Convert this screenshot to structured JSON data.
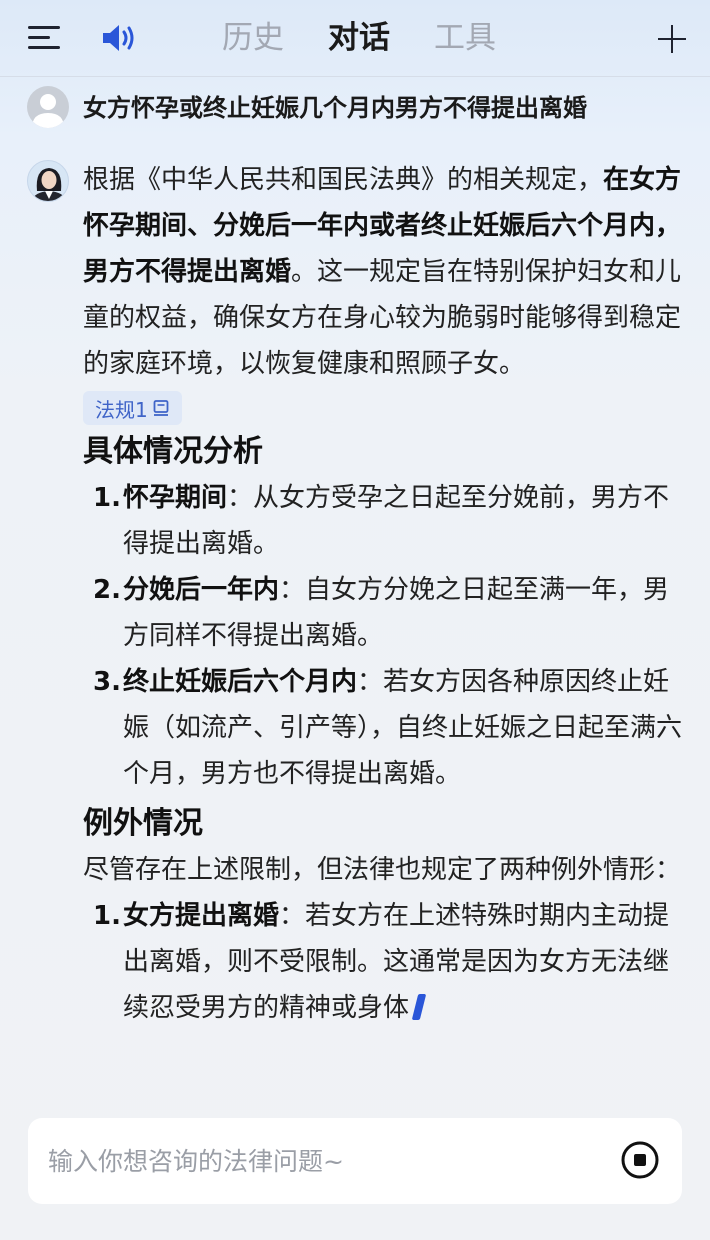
{
  "header": {
    "tabs": [
      {
        "label": "历史",
        "active": false
      },
      {
        "label": "对话",
        "active": true
      },
      {
        "label": "工具",
        "active": false
      }
    ],
    "icons": {
      "menu": "menu-icon",
      "speaker": "speaker-icon",
      "new_chat": "plus-icon"
    },
    "accent_color": "#2a56d8"
  },
  "question": {
    "text": "女方怀孕或终止妊娠几个月内男方不得提出离婚"
  },
  "answer": {
    "intro": {
      "pre": "根据《中华人民共和国民法典》的相关规定，",
      "bold": "在女方怀孕期间、分娩后一年内或者终止妊娠后六个月内，男方不得提出离婚",
      "post": "。这一规定旨在特别保护妇女和儿童的权益，确保女方在身心较为脆弱时能够得到稳定的家庭环境，以恢复健康和照顾子女。"
    },
    "citation": {
      "label": "法规1",
      "icon": "book-icon"
    },
    "section1": {
      "heading": "具体情况分析",
      "items": [
        {
          "num": "1.",
          "term": "怀孕期间",
          "text": "：从女方受孕之日起至分娩前，男方不得提出离婚。"
        },
        {
          "num": "2.",
          "term": "分娩后一年内",
          "text": "：自女方分娩之日起至满一年，男方同样不得提出离婚。"
        },
        {
          "num": "3.",
          "term": "终止妊娠后六个月内",
          "text": "：若女方因各种原因终止妊娠（如流产、引产等），自终止妊娠之日起至满六个月，男方也不得提出离婚。"
        }
      ]
    },
    "section2": {
      "heading": "例外情况",
      "intro": "尽管存在上述限制，但法律也规定了两种例外情形：",
      "items": [
        {
          "num": "1.",
          "term": "女方提出离婚",
          "text": "：若女方在上述特殊时期内主动提出离婚，则不受限制。这通常是因为女方无法继续忍受男方的精神或身体"
        }
      ]
    }
  },
  "input": {
    "placeholder": "输入你想咨询的法律问题~",
    "value": "",
    "stop_icon": "stop-icon"
  }
}
